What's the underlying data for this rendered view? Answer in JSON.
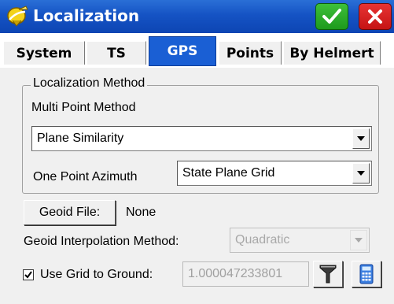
{
  "window": {
    "title": "Localization",
    "app_icon": "satellite-dish-icon",
    "ok_icon": "checkmark-icon",
    "close_icon": "close-x-icon",
    "ok_color": "#2eb02b",
    "close_color": "#d91e1e",
    "titlebar_color": "#1553c4"
  },
  "tabs": [
    {
      "label": "System",
      "active": false
    },
    {
      "label": "TS",
      "active": false
    },
    {
      "label": "GPS",
      "active": true
    },
    {
      "label": "Points",
      "active": false
    },
    {
      "label": "By Helmert",
      "active": false
    }
  ],
  "localization_method": {
    "group_label": "Localization Method",
    "multi_point_label": "Multi Point Method",
    "multi_point_value": "Plane Similarity",
    "one_point_label": "One Point Azimuth",
    "one_point_value": "State Plane Grid"
  },
  "geoid": {
    "file_button": "Geoid File:",
    "file_value": "None",
    "interp_label": "Geoid Interpolation Method:",
    "interp_value": "Quadratic"
  },
  "grid_to_ground": {
    "checked": true,
    "label": "Use Grid to Ground:",
    "value": "1.000047233801",
    "filter_icon": "funnel-filter-icon",
    "calc_icon": "calculator-icon"
  }
}
